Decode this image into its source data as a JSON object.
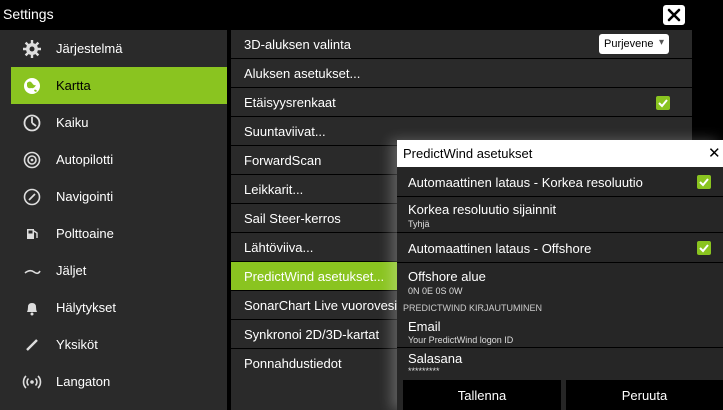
{
  "window": {
    "title": "Settings"
  },
  "sidebar": {
    "items": [
      {
        "label": "Järjestelmä",
        "icon": "gear-icon"
      },
      {
        "label": "Kartta",
        "icon": "chart-globe-icon"
      },
      {
        "label": "Kaiku",
        "icon": "echo-icon"
      },
      {
        "label": "Autopilotti",
        "icon": "autopilot-icon"
      },
      {
        "label": "Navigointi",
        "icon": "compass-icon"
      },
      {
        "label": "Polttoaine",
        "icon": "fuel-icon"
      },
      {
        "label": "Jäljet",
        "icon": "trail-icon"
      },
      {
        "label": "Hälytykset",
        "icon": "bell-icon"
      },
      {
        "label": "Yksiköt",
        "icon": "ruler-icon"
      },
      {
        "label": "Langaton",
        "icon": "wireless-icon"
      }
    ],
    "active_index": 1
  },
  "main": {
    "rows": [
      {
        "label": "3D-aluksen valinta",
        "select_value": "Purjevene"
      },
      {
        "label": "Aluksen asetukset..."
      },
      {
        "label": "Etäisyysrenkaat",
        "checked": true
      },
      {
        "label": "Suuntaviivat..."
      },
      {
        "label": "ForwardScan"
      },
      {
        "label": "Leikkarit..."
      },
      {
        "label": "Sail Steer-kerros"
      },
      {
        "label": "Lähtöviiva..."
      },
      {
        "label": "PredictWind asetukset..."
      },
      {
        "label": "SonarChart Live vuorovesikorjaus"
      },
      {
        "label": "Synkronoi 2D/3D-kartat"
      },
      {
        "label": "Ponnahdustiedot"
      }
    ],
    "active_index": 8
  },
  "dialog": {
    "title": "PredictWind asetukset",
    "auto_hires": {
      "label": "Automaattinen lataus - Korkea resoluutio",
      "checked": true
    },
    "hires_locations": {
      "label": "Korkea resoluutio sijainnit",
      "value": "Tyhjä"
    },
    "auto_offshore": {
      "label": "Automaattinen lataus - Offshore",
      "checked": true
    },
    "offshore_area": {
      "label": "Offshore alue",
      "value": "0N 0E 0S 0W"
    },
    "section_title": "PREDICTWIND KIRJAUTUMINEN",
    "email": {
      "label": "Email",
      "value": "Your PredictWind logon ID"
    },
    "password": {
      "label": "Salasana",
      "value": "*********"
    },
    "save_label": "Tallenna",
    "cancel_label": "Peruuta"
  },
  "colors": {
    "accent": "#8ac420",
    "panel": "#2a2a2a",
    "background": "#000000"
  }
}
